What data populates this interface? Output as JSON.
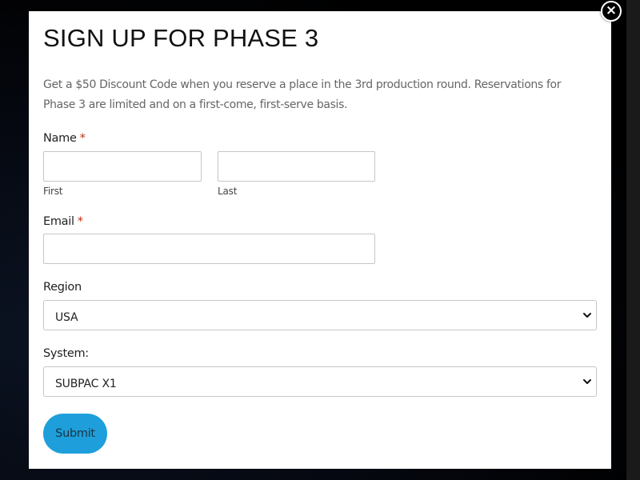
{
  "modal": {
    "title": "SIGN UP FOR PHASE 3",
    "description": "Get a $50 Discount Code when you reserve a place in the 3rd production round. Reservations for Phase 3 are limited and on a first-come, first-serve basis.",
    "close_icon": "×"
  },
  "form": {
    "name": {
      "label": "Name",
      "required_marker": "*",
      "first": {
        "value": "",
        "sublabel": "First"
      },
      "last": {
        "value": "",
        "sublabel": "Last"
      }
    },
    "email": {
      "label": "Email",
      "required_marker": "*",
      "value": ""
    },
    "region": {
      "label": "Region",
      "selected": "USA"
    },
    "system": {
      "label": "System:",
      "selected": "SUBPAC X1"
    },
    "submit_label": "Submit"
  },
  "icons": {
    "close": "close-icon",
    "select_arrow": "chevron-down-icon"
  },
  "colors": {
    "overlay": "#000000",
    "accent": "#1e9fdb",
    "required": "#c02b0a"
  }
}
